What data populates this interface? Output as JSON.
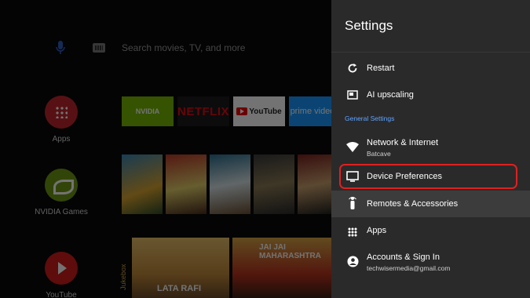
{
  "launcher": {
    "search_placeholder": "Search movies, TV, and more",
    "rows": [
      {
        "label": "Apps",
        "icon": "apps-grid-icon"
      },
      {
        "label": "NVIDIA Games",
        "icon": "nvidia-icon"
      },
      {
        "label": "YouTube",
        "icon": "youtube-icon"
      }
    ],
    "app_tiles": {
      "nvidia": "NVIDIA",
      "netflix": "NETFLIX",
      "youtube": "YouTube",
      "prime": "prime video"
    },
    "jukebox_label": "Jukebox",
    "video_captions": [
      "LATA RAFI",
      "JAI JAI MAHARASHTRA"
    ]
  },
  "settings": {
    "title": "Settings",
    "items": [
      {
        "label": "Restart",
        "icon": "restart-icon"
      },
      {
        "label": "AI upscaling",
        "icon": "picture-in-picture-icon"
      }
    ],
    "section_header": "General Settings",
    "general_items": [
      {
        "label": "Network & Internet",
        "sublabel": "Batcave",
        "icon": "wifi-icon"
      },
      {
        "label": "Device Preferences",
        "icon": "tv-icon"
      },
      {
        "label": "Remotes & Accessories",
        "icon": "remote-icon"
      },
      {
        "label": "Apps",
        "icon": "apps-grid-icon"
      },
      {
        "label": "Accounts & Sign In",
        "sublabel": "techwisermedia@gmail.com",
        "icon": "account-icon"
      }
    ],
    "focus_ring_color": "#e02020",
    "section_header_color": "#5fa4ff"
  }
}
